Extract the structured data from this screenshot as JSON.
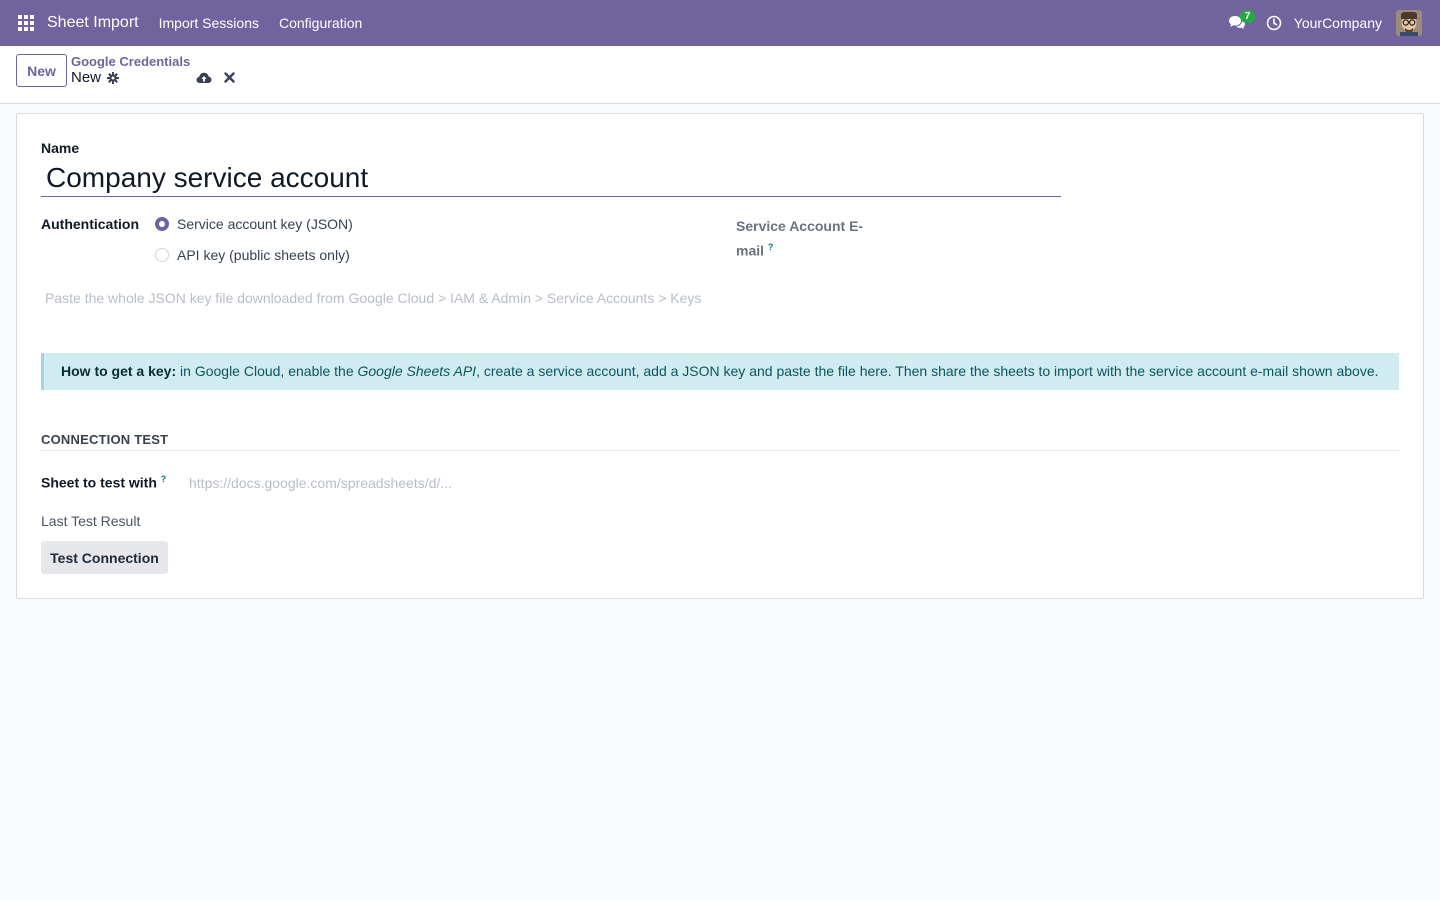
{
  "navbar": {
    "brand": "Sheet Import",
    "menu": [
      {
        "label": "Import Sessions"
      },
      {
        "label": "Configuration"
      }
    ],
    "chat_count": "7",
    "company": "YourCompany",
    "icons": {
      "apps": "apps-grid-icon",
      "chat": "chat-icon",
      "activity": "clock-icon"
    }
  },
  "control_panel": {
    "new_label": "New",
    "breadcrumb": "Google Credentials",
    "record_title": "New"
  },
  "form": {
    "name_label": "Name",
    "name_value": "Company service account",
    "auth_label": "Authentication",
    "auth_options": [
      {
        "label": "Service account key (JSON)",
        "selected": true
      },
      {
        "label": "API key (public sheets only)",
        "selected": false
      }
    ],
    "service_account_email_label": "Service Account E-mail",
    "help_marker": "?",
    "json_placeholder": "Paste the whole JSON key file downloaded from Google Cloud > IAM & Admin > Service Accounts > Keys",
    "alert": {
      "bold": "How to get a key:",
      "text_before": " in Google Cloud, enable the ",
      "italic": "Google Sheets API",
      "text_after": ", create a service account, add a JSON key and paste the file here. Then share the sheets to import with the service account e-mail shown above."
    },
    "section_title": "CONNECTION TEST",
    "sheet_label": "Sheet to test with",
    "sheet_placeholder": "https://docs.google.com/spreadsheets/d/...",
    "last_result_label": "Last Test Result",
    "test_button": "Test Connection"
  },
  "colors": {
    "brand": "#71639e",
    "alert_bg": "#d1ecf1",
    "badge": "#28a745"
  }
}
